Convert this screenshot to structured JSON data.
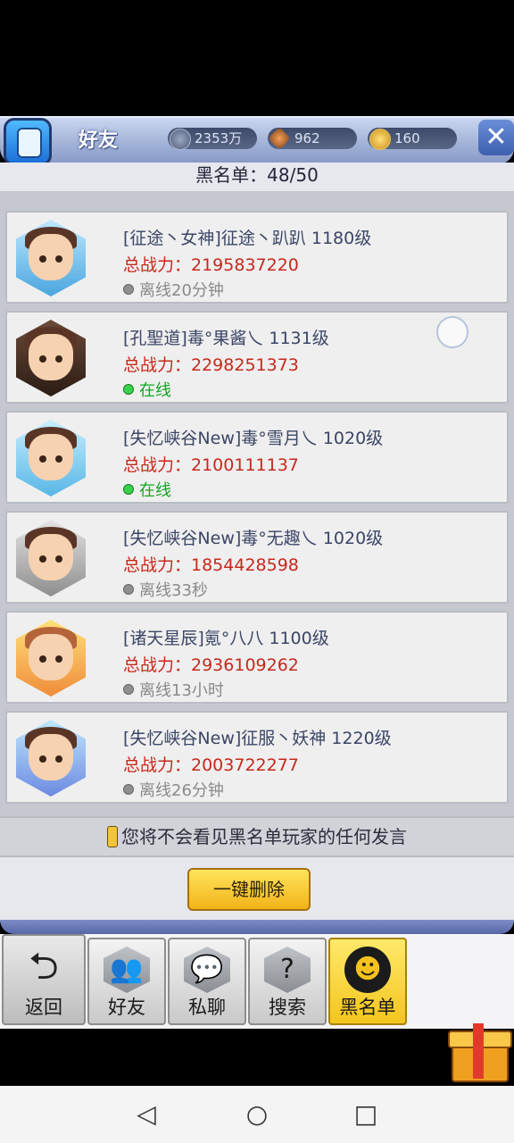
{
  "header": {
    "title": "好友",
    "resources": [
      {
        "icon": "power-orb-icon",
        "value": "2353万"
      },
      {
        "icon": "diamond-crystal-icon",
        "value": "962"
      },
      {
        "icon": "gold-coin-icon",
        "value": "160"
      }
    ],
    "close_label": "✕"
  },
  "blacklist": {
    "count_label": "黑名单：48/50"
  },
  "rows": [
    {
      "name": "[征途丶女神]征途丶趴趴 1180级",
      "power": "总战力：2195837220",
      "status": "离线20分钟",
      "online": false
    },
    {
      "name": "[孔聖道]毒°果酱乀 1131级",
      "power": "总战力：2298251373",
      "status": "在线",
      "online": true
    },
    {
      "name": "[失忆峡谷New]毒°雪月乀  1020级",
      "power": "总战力：2100111137",
      "status": "在线",
      "online": true
    },
    {
      "name": "[失忆峡谷New]毒°无趣乀 1020级",
      "power": "总战力：1854428598",
      "status": "离线33秒",
      "online": false
    },
    {
      "name": "[诸天星辰]氪°八八 1100级",
      "power": "总战力：2936109262",
      "status": "离线13小时",
      "online": false
    },
    {
      "name": "[失忆峡谷New]征服丶妖神 1220级",
      "power": "总战力：2003722277",
      "status": "离线26分钟",
      "online": false
    }
  ],
  "notice": "您将不会看见黑名单玩家的任何发言",
  "delete_all_label": "一键删除",
  "tabs": {
    "back": "返回",
    "friends": "好友",
    "chat": "私聊",
    "search": "搜索",
    "blacklist": "黑名单"
  },
  "colors": {
    "power_red": "#c8281c",
    "online_green": "#13a523",
    "active_tab_yellow": "#f4c51e"
  }
}
